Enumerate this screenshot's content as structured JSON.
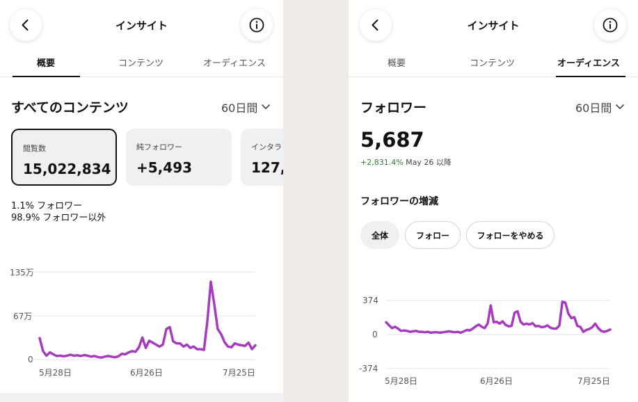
{
  "left": {
    "title": "インサイト",
    "tabs": [
      {
        "label": "概要"
      },
      {
        "label": "コンテンツ"
      },
      {
        "label": "オーディエンス"
      }
    ],
    "section_title": "すべてのコンテンツ",
    "period": "60日間",
    "cards": [
      {
        "label": "閲覧数",
        "value": "15,022,834"
      },
      {
        "label": "純フォロワー",
        "value": "+5,493"
      },
      {
        "label": "インタラ",
        "value": "127,4"
      }
    ],
    "pct_followers": "1.1% フォロワー",
    "pct_non_followers": "98.9% フォロワー以外"
  },
  "right": {
    "title": "インサイト",
    "tabs": [
      {
        "label": "概要"
      },
      {
        "label": "コンテンツ"
      },
      {
        "label": "オーディエンス"
      }
    ],
    "section_title": "フォロワー",
    "period": "60日間",
    "big_number": "5,687",
    "change": "+2,831.4%",
    "change_since": "May 26 以降",
    "growth_title": "フォロワーの増減",
    "filters": [
      {
        "label": "全体"
      },
      {
        "label": "フォロー"
      },
      {
        "label": "フォローをやめる"
      }
    ]
  },
  "icons": {
    "back": "chevron-left-icon",
    "info": "info-icon",
    "dropdown": "chevron-down-icon"
  },
  "colors": {
    "line": "#a63bbd",
    "change_positive": "#2e7d32"
  },
  "chart_data": [
    {
      "type": "line",
      "title": "",
      "y_tick_labels": [
        "135万",
        "67万",
        "0"
      ],
      "x_tick_labels": [
        "5月28日",
        "6月26日",
        "7月25日"
      ],
      "ylim": [
        0,
        1350000
      ],
      "grid": true,
      "series": [
        {
          "values": [
            330000,
            130000,
            60000,
            110000,
            80000,
            55000,
            60000,
            50000,
            60000,
            75000,
            60000,
            65000,
            55000,
            70000,
            60000,
            45000,
            55000,
            40000,
            30000,
            45000,
            55000,
            45000,
            35000,
            50000,
            90000,
            80000,
            110000,
            130000,
            120000,
            190000,
            340000,
            180000,
            290000,
            260000,
            230000,
            200000,
            230000,
            470000,
            500000,
            280000,
            250000,
            250000,
            200000,
            230000,
            180000,
            200000,
            160000,
            160000,
            150000,
            600000,
            1200000,
            850000,
            470000,
            390000,
            270000,
            200000,
            190000,
            250000,
            230000,
            220000,
            210000,
            260000,
            160000,
            220000
          ]
        }
      ]
    },
    {
      "type": "line",
      "title": "",
      "y_tick_labels": [
        "374",
        "0",
        "-374"
      ],
      "x_tick_labels": [
        "5月28日",
        "6月26日",
        "7月25日"
      ],
      "ylim": [
        -374,
        374
      ],
      "grid": true,
      "series": [
        {
          "values": [
            135,
            100,
            70,
            85,
            65,
            40,
            45,
            40,
            30,
            35,
            40,
            30,
            30,
            25,
            30,
            20,
            25,
            25,
            20,
            25,
            30,
            35,
            30,
            25,
            30,
            20,
            35,
            50,
            45,
            65,
            90,
            110,
            85,
            70,
            125,
            320,
            135,
            140,
            120,
            145,
            105,
            90,
            95,
            240,
            255,
            140,
            110,
            120,
            110,
            125,
            90,
            95,
            80,
            85,
            100,
            75,
            65,
            65,
            100,
            360,
            350,
            230,
            180,
            190,
            95,
            85,
            30,
            50,
            60,
            80,
            120,
            70,
            40,
            30,
            40,
            55
          ]
        }
      ]
    }
  ]
}
